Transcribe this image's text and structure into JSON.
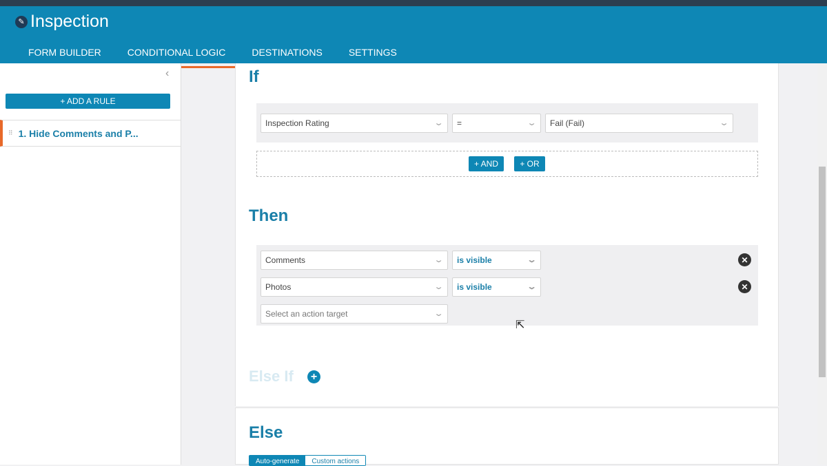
{
  "header": {
    "title": "Inspection",
    "tabs": [
      "FORM BUILDER",
      "CONDITIONAL LOGIC",
      "DESTINATIONS",
      "SETTINGS"
    ],
    "active_tab": 1
  },
  "sidebar": {
    "add_rule": "+ ADD A RULE",
    "rules": [
      "1. Hide Comments and P..."
    ]
  },
  "if": {
    "heading": "If",
    "field": "Inspection Rating",
    "operator": "=",
    "value": "Fail (Fail)",
    "and_label": "+ AND",
    "or_label": "+ OR"
  },
  "then": {
    "heading": "Then",
    "actions": [
      {
        "target": "Comments",
        "state": "is visible"
      },
      {
        "target": "Photos",
        "state": "is visible"
      }
    ],
    "placeholder": "Select an action target"
  },
  "else_if": {
    "heading": "Else If"
  },
  "else": {
    "heading": "Else",
    "modes": [
      "Auto-generate",
      "Custom actions"
    ]
  }
}
